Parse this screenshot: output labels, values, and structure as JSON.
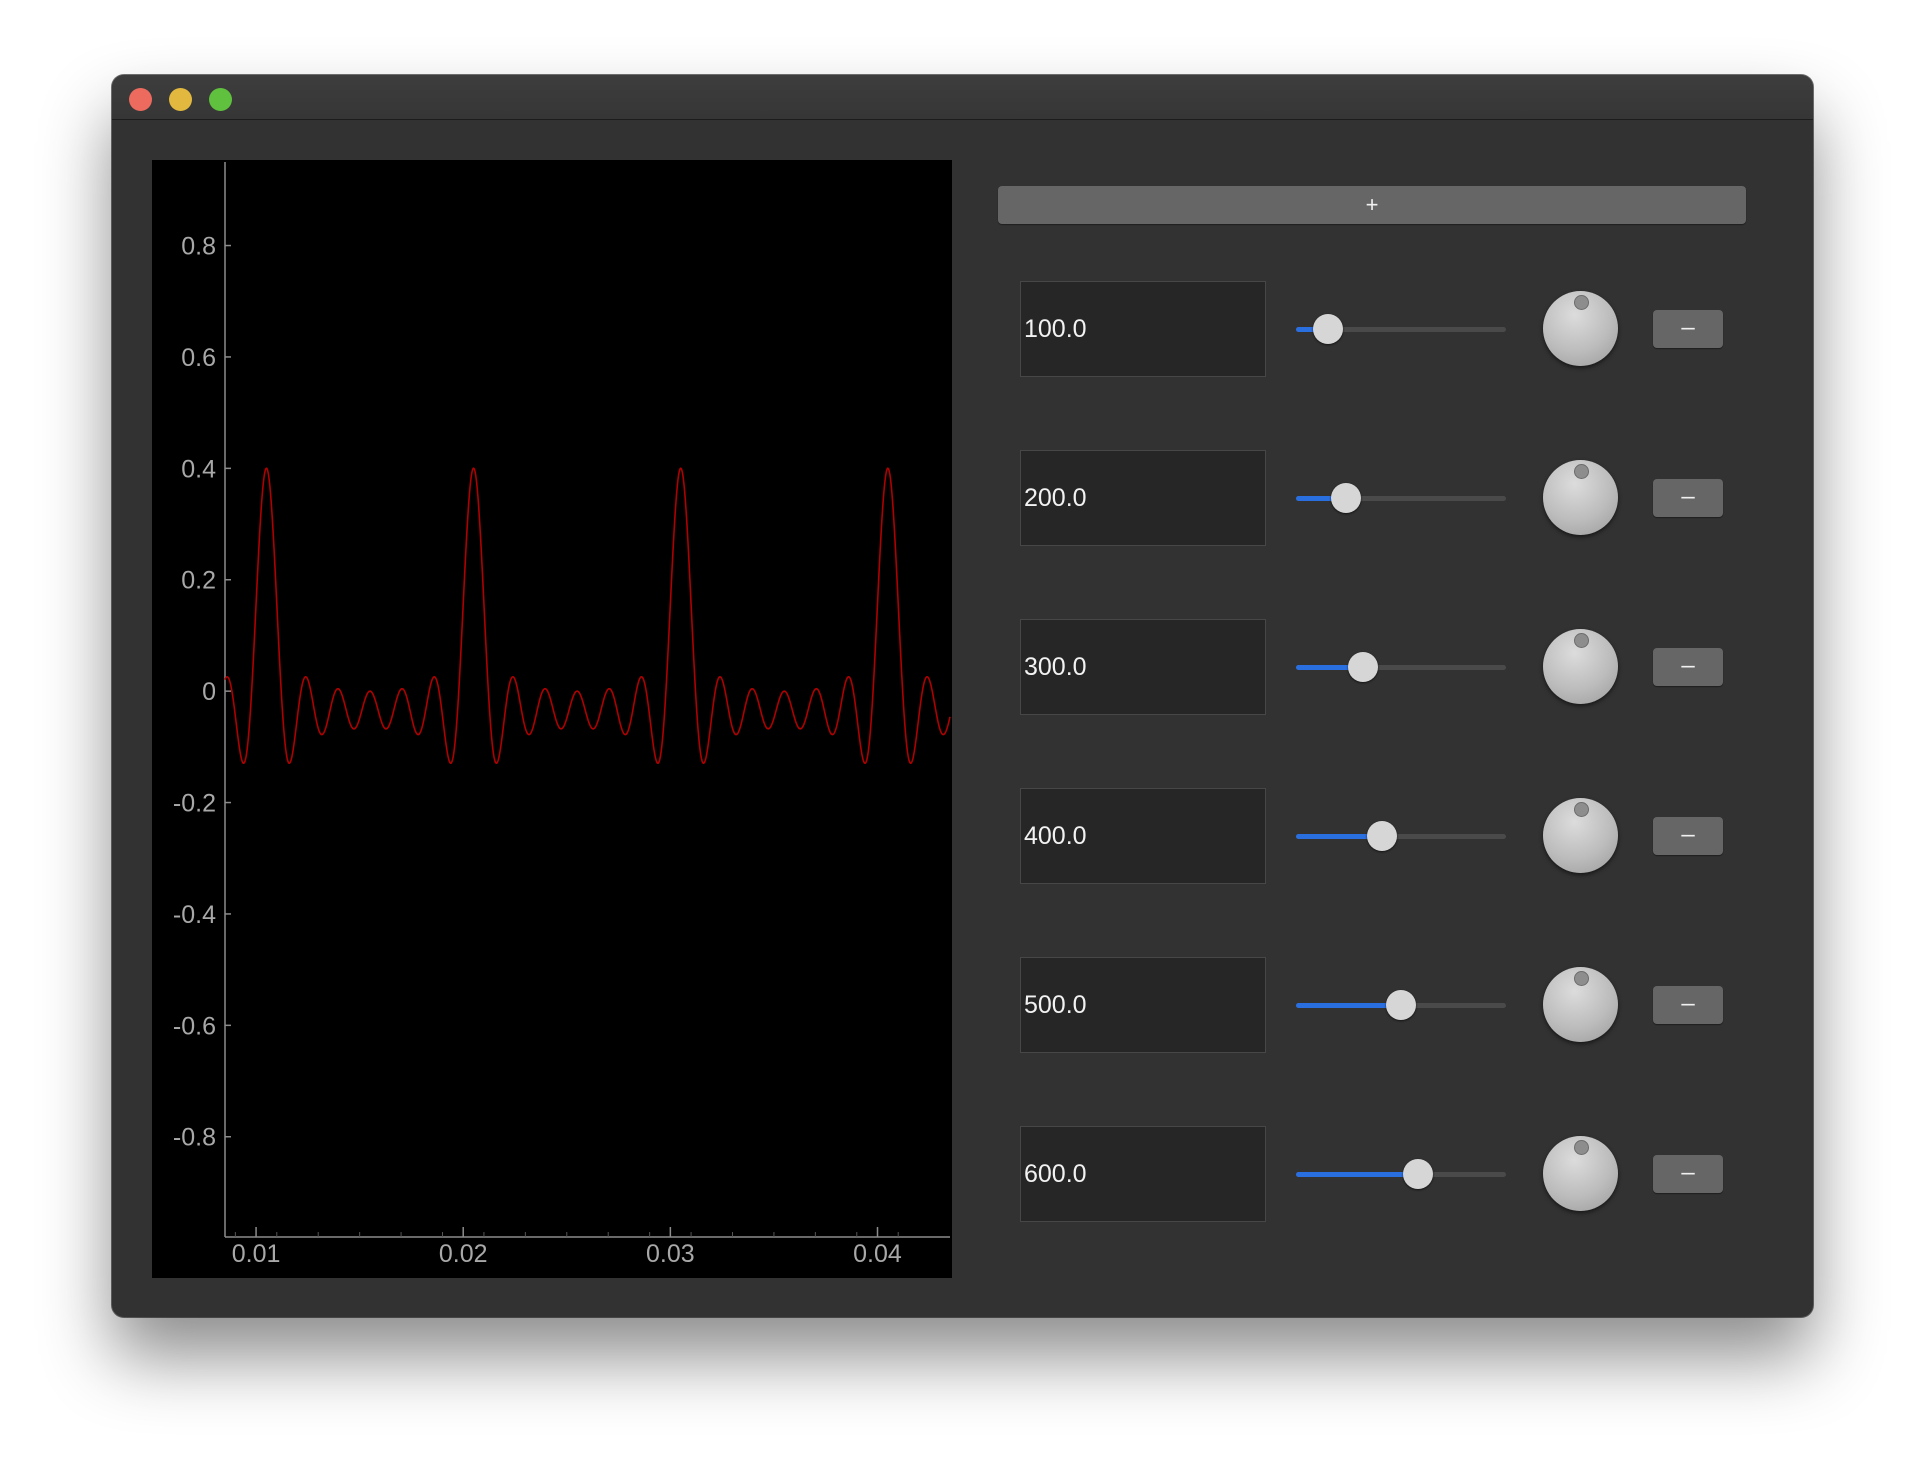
{
  "window": {
    "controls": [
      "close",
      "minimize",
      "maximize"
    ]
  },
  "toolbar": {
    "add_label": "+"
  },
  "oscillators": [
    {
      "value": "100.0",
      "slider_fraction": 0.15,
      "remove_label": "–"
    },
    {
      "value": "200.0",
      "slider_fraction": 0.24,
      "remove_label": "–"
    },
    {
      "value": "300.0",
      "slider_fraction": 0.32,
      "remove_label": "–"
    },
    {
      "value": "400.0",
      "slider_fraction": 0.41,
      "remove_label": "–"
    },
    {
      "value": "500.0",
      "slider_fraction": 0.5,
      "remove_label": "–"
    },
    {
      "value": "600.0",
      "slider_fraction": 0.58,
      "remove_label": "–"
    }
  ],
  "colors": {
    "window_bg": "#323232",
    "plot_bg": "#000000",
    "curve": "#b00000",
    "axis": "#8c8c8c",
    "slider_fill": "#2a6fe0"
  },
  "chart_data": {
    "type": "line",
    "xlim": [
      0.0085,
      0.0435
    ],
    "ylim": [
      -0.98,
      0.95
    ],
    "x_ticks": [
      0.01,
      0.02,
      0.03,
      0.04
    ],
    "x_tick_labels": [
      "0.01",
      "0.02",
      "0.03",
      "0.04"
    ],
    "y_ticks": [
      0.8,
      0.6,
      0.4,
      0.2,
      0,
      -0.2,
      -0.4,
      -0.6,
      -0.8
    ],
    "y_tick_labels": [
      "0.8",
      "0.6",
      "0.4",
      "0.2",
      "0",
      "-0.2",
      "-0.4",
      "-0.6",
      "-0.8"
    ],
    "series": [
      {
        "harmonics_hz": [
          100,
          200,
          300,
          400,
          500,
          600
        ],
        "amplitude_each": 0.0667
      }
    ],
    "grid": false
  }
}
